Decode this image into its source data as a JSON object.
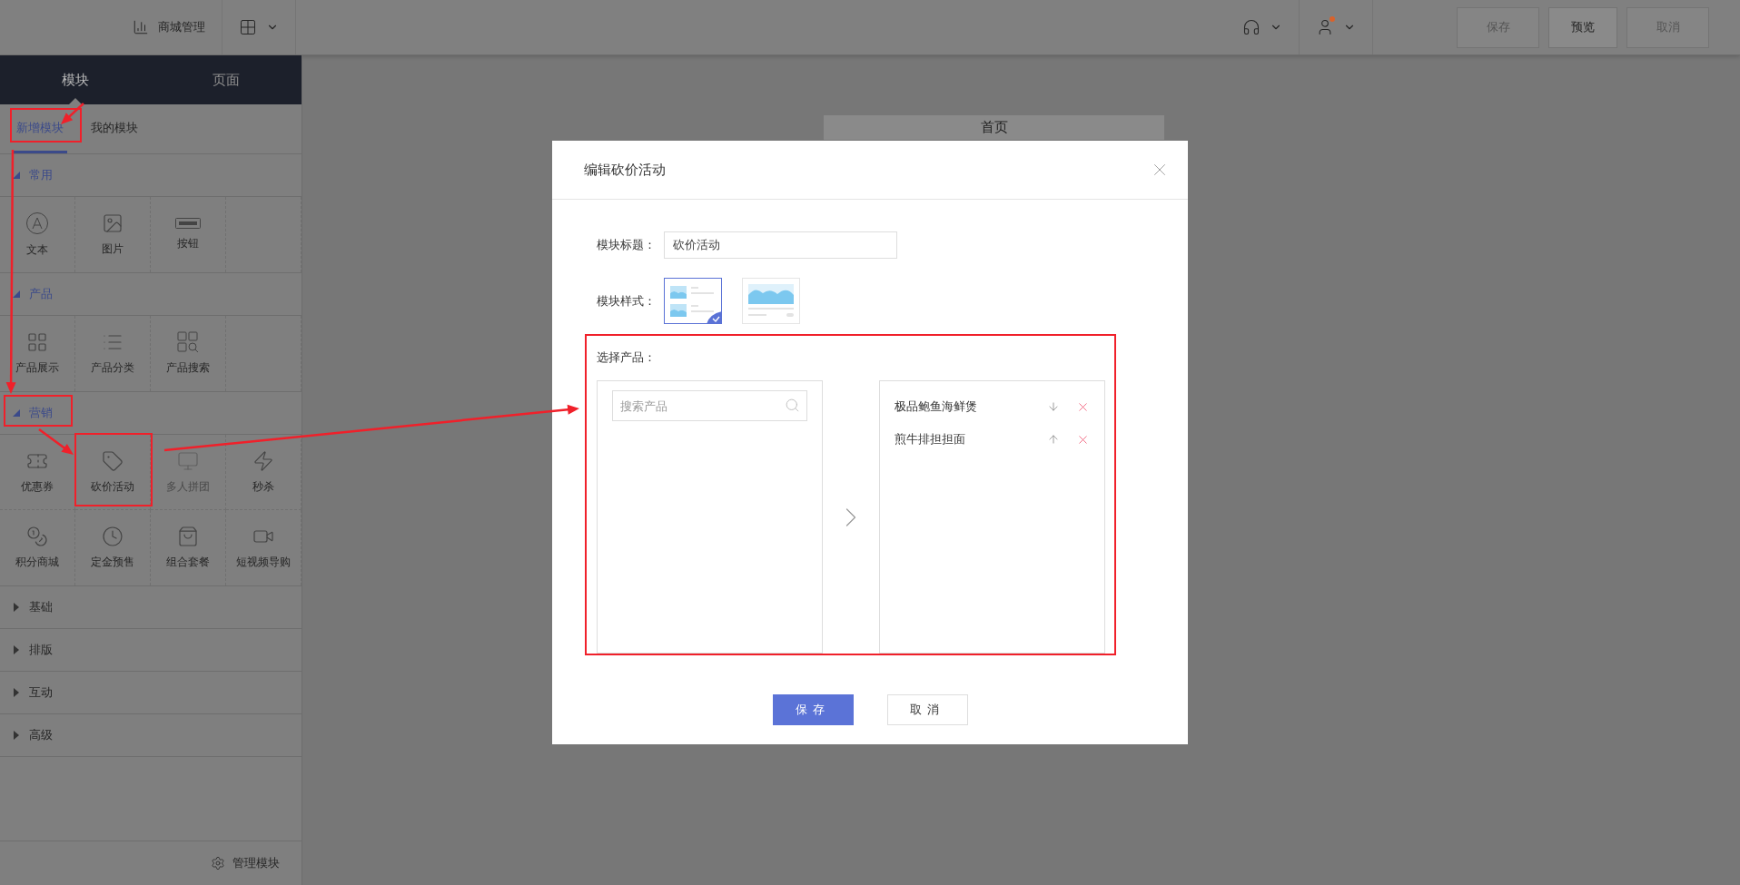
{
  "top_bar": {
    "store_menu": "商城管理",
    "user_notification": true,
    "actions": [
      {
        "label": "保存",
        "disabled": true
      },
      {
        "label": "预览",
        "disabled": false
      },
      {
        "label": "取消",
        "disabled": true
      }
    ]
  },
  "sidebar": {
    "tabs": [
      {
        "label": "模块",
        "selected": true
      },
      {
        "label": "页面",
        "selected": false
      }
    ],
    "sub_tabs": [
      {
        "label": "新增模块",
        "selected": true
      },
      {
        "label": "我的模块",
        "selected": false
      }
    ],
    "sections": [
      {
        "title": "常用",
        "expanded": true,
        "items": [
          {
            "label": "文本",
            "disabled": false
          },
          {
            "label": "图片",
            "disabled": false
          },
          {
            "label": "按钮",
            "disabled": false
          }
        ]
      },
      {
        "title": "产品",
        "expanded": true,
        "items": [
          {
            "label": "产品展示",
            "disabled": false
          },
          {
            "label": "产品分类",
            "disabled": false
          },
          {
            "label": "产品搜索",
            "disabled": false
          }
        ]
      },
      {
        "title": "营销",
        "expanded": true,
        "items": [
          {
            "label": "优惠券",
            "disabled": false
          },
          {
            "label": "砍价活动",
            "disabled": false
          },
          {
            "label": "多人拼团",
            "disabled": true
          },
          {
            "label": "秒杀",
            "disabled": false
          },
          {
            "label": "积分商城",
            "disabled": false
          },
          {
            "label": "定金预售",
            "disabled": false
          },
          {
            "label": "组合套餐",
            "disabled": false
          },
          {
            "label": "短视频导购",
            "disabled": false
          }
        ]
      },
      {
        "title": "基础",
        "expanded": false
      },
      {
        "title": "排版",
        "expanded": false
      },
      {
        "title": "互动",
        "expanded": false
      },
      {
        "title": "高级",
        "expanded": false
      }
    ],
    "footer": "管理模块"
  },
  "canvas": {
    "page_title": "首页"
  },
  "dialog": {
    "title": "编辑砍价活动",
    "title_label": "模块标题：",
    "title_value": "砍价活动",
    "style_label": "模块样式：",
    "styles": [
      {
        "kind": "list",
        "selected": true
      },
      {
        "kind": "banner",
        "selected": false
      }
    ],
    "product_label": "选择产品：",
    "search_placeholder": "搜索产品",
    "selected_products": [
      {
        "name": "极品鲍鱼海鲜煲",
        "kind": "down"
      },
      {
        "name": "煎牛排担担面",
        "kind": "up"
      }
    ],
    "buttons": [
      {
        "label": "保存",
        "kind": "primary"
      },
      {
        "label": "取消",
        "kind": "default"
      }
    ]
  }
}
